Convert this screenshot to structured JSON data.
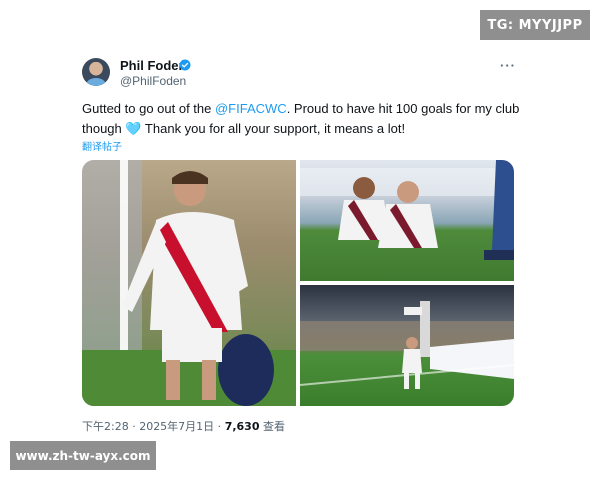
{
  "watermarks": {
    "top_right": "TG: MYYJJPP",
    "bottom_left": "www.zh-tw-ayx.com"
  },
  "tweet": {
    "display_name": "Phil Foden",
    "handle": "@PhilFoden",
    "more_label": "···",
    "text_part1": "Gutted to go out of the ",
    "mention": "@FIFACWC",
    "text_part2": ". Proud to have hit 100 goals for my club though 🩵 Thank you for all your support, it means a lot!",
    "translate_label": "翻译帖子",
    "time": "下午2:28 · 2025年7月1日 · ",
    "views_count": "7,630",
    "views_label": " 查看"
  },
  "icons": {
    "verified": "verified-badge-icon",
    "more": "more-options-icon"
  },
  "colors": {
    "accent": "#1d9bf0",
    "text": "#0f1419",
    "muted": "#536471",
    "watermark_bg": "#8f8f8f"
  }
}
